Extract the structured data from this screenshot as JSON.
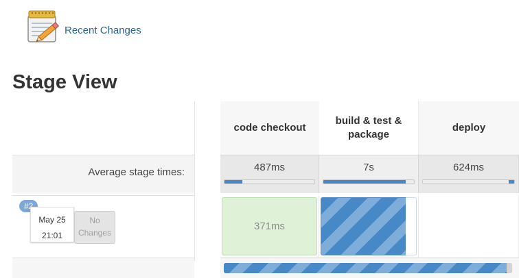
{
  "header": {
    "recent_changes": "Recent Changes"
  },
  "page_title": "Stage View",
  "stages": [
    {
      "name": "code checkout",
      "avg_time": "487ms",
      "avg_progress": 0.2
    },
    {
      "name": "build & test & package",
      "avg_time": "7s",
      "avg_progress": 0.91
    },
    {
      "name": "deploy",
      "avg_time": "624ms",
      "avg_progress": 0.06
    }
  ],
  "average_label": "Average stage times:",
  "builds": [
    {
      "number": "#2",
      "date": "May 25",
      "time": "21:01",
      "changes_line1": "No",
      "changes_line2": "Changes",
      "cells": [
        {
          "status": "success",
          "duration": "371ms"
        },
        {
          "status": "running",
          "progress": 0.89
        },
        {
          "status": "pending"
        }
      ]
    }
  ],
  "overall_progress": 0.98,
  "colors": {
    "link": "#2a6496",
    "success_bg": "#dff2d8",
    "running": "#4788c7",
    "badge": "#7fa7d6"
  },
  "icons": {
    "recent_changes": "notepad-pencil-icon"
  }
}
